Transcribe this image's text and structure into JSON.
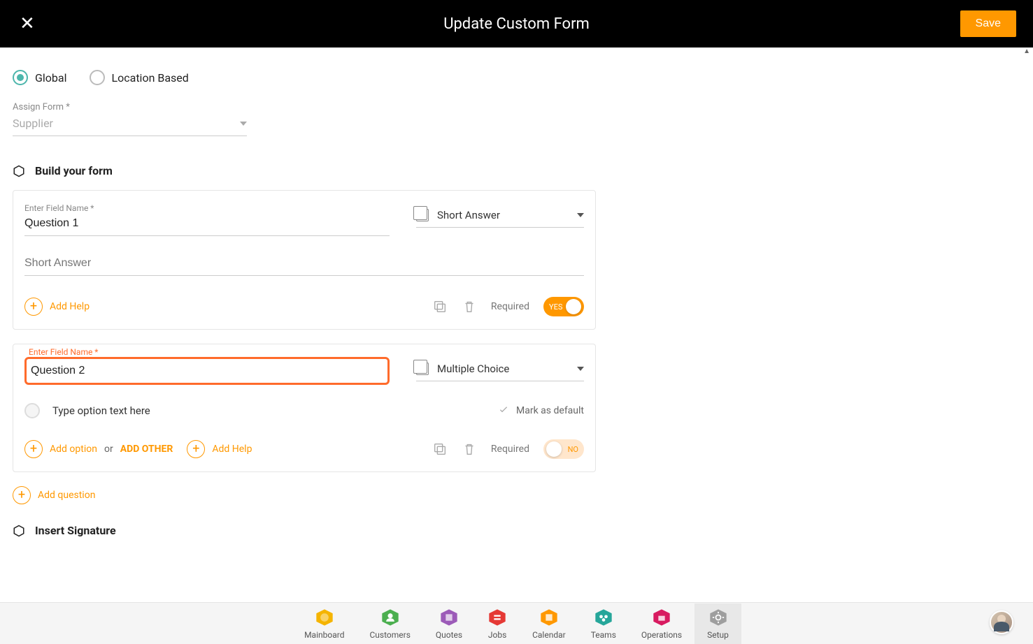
{
  "header": {
    "title": "Update Custom Form",
    "save_label": "Save"
  },
  "scope": {
    "global_label": "Global",
    "location_label": "Location Based",
    "selected": "global"
  },
  "assign_form": {
    "label": "Assign Form *",
    "value": "Supplier"
  },
  "sections": {
    "build_title": "Build your form",
    "signature_title": "Insert Signature"
  },
  "fields": [
    {
      "name_label": "Enter Field Name *",
      "name_value": "Question 1",
      "type_label": "Short Answer",
      "answer_placeholder": "Short Answer",
      "add_help_label": "Add Help",
      "required_label": "Required",
      "required_on": true,
      "toggle_text": "YES"
    },
    {
      "name_label": "Enter Field Name *",
      "name_value": "Question 2",
      "type_label": "Multiple Choice",
      "option_placeholder": "Type option text here",
      "mark_default_label": "Mark as default",
      "add_option_label": "Add option",
      "or_text": "or",
      "add_other_label": "ADD OTHER",
      "add_help_label": "Add Help",
      "required_label": "Required",
      "required_on": false,
      "toggle_text": "NO"
    }
  ],
  "add_question_label": "Add question",
  "nav": [
    {
      "label": "Mainboard",
      "color": "#f5b400"
    },
    {
      "label": "Customers",
      "color": "#4caf50"
    },
    {
      "label": "Quotes",
      "color": "#9c5bb8"
    },
    {
      "label": "Jobs",
      "color": "#e53935"
    },
    {
      "label": "Calendar",
      "color": "#ff9800"
    },
    {
      "label": "Teams",
      "color": "#26a69a"
    },
    {
      "label": "Operations",
      "color": "#d81b60"
    },
    {
      "label": "Setup",
      "color": "#9e9e9e"
    }
  ]
}
